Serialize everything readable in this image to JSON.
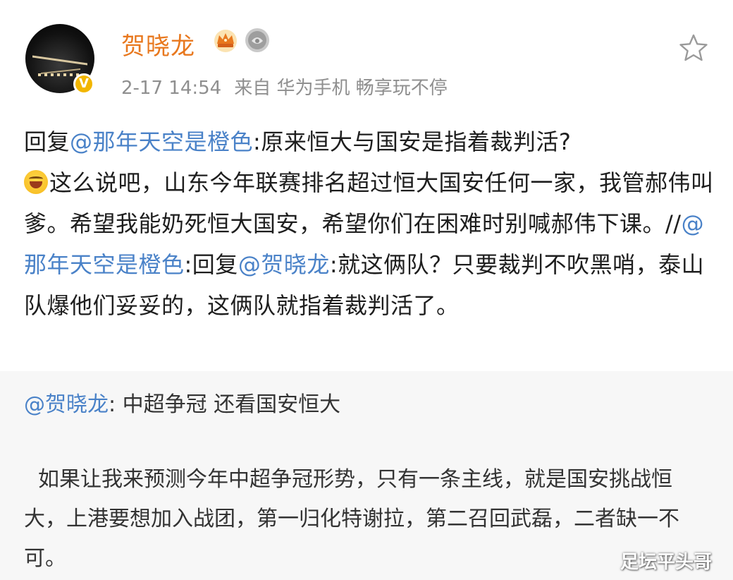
{
  "post": {
    "username": "贺晓龙",
    "timestamp": "2-17 14:54",
    "source_prefix": "来自",
    "source_device": "华为手机 畅享玩不停",
    "reply_prefix": "回复",
    "reply_mention": "@那年天空是橙色",
    "text_part1": ":原来恒大与国安是指着裁判活?",
    "text_part2": "这么说吧，山东今年联赛排名超过恒大国安任何一家，我管郝伟叫爹。希望我能奶死恒大国安，希望你们在困难时别喊郝伟下课。//",
    "mention2": "@那年天空是橙色",
    "text_part3": ":回复",
    "mention3": "@贺晓龙",
    "text_part4": ":就这俩队？只要裁判不吹黑哨，泰山队爆他们妥妥的，这俩队就指着裁判活了。"
  },
  "quoted": {
    "mention": "@贺晓龙",
    "text": ": 中超争冠  还看国安恒大",
    "body": "如果让我来预测今年中超争冠形势，只有一条主线，就是国安挑战恒大，上港要想加入战团，第一归化特谢拉，第二召回武磊，二者缺一不可。"
  },
  "badges": {
    "verified": "V"
  },
  "watermark": "足坛平头哥",
  "colors": {
    "username": "#e8781e",
    "mention": "#4a82c8",
    "meta": "#8f8f8f",
    "verified_badge": "#f2b600",
    "quoted_bg": "#f7f7f7"
  },
  "icons": [
    "crown-icon",
    "medal-icon",
    "star-icon",
    "laughing-emoji-icon",
    "verified-badge-icon"
  ]
}
